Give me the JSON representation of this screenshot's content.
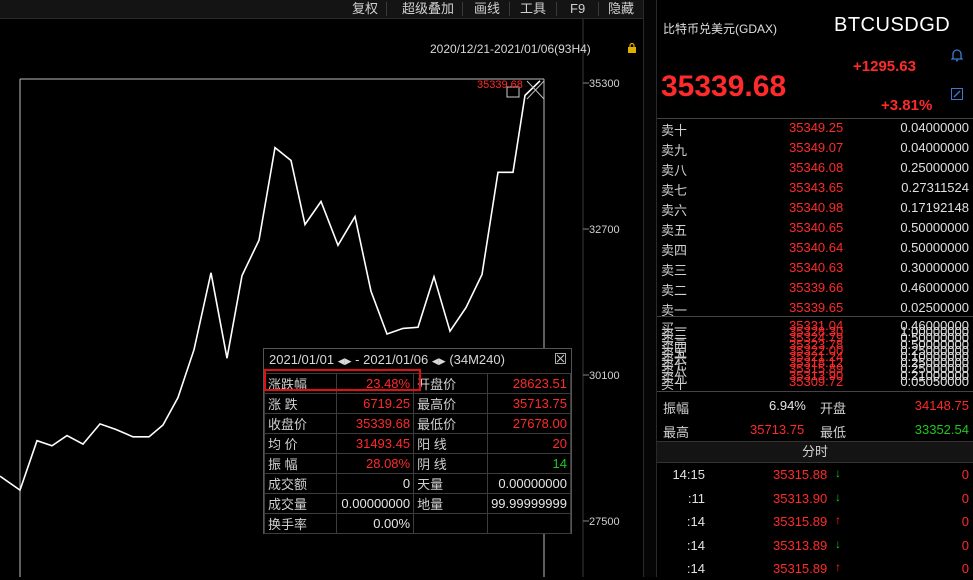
{
  "toolbar": {
    "items": [
      "复权",
      "超级叠加",
      "画线",
      "工具",
      "F9",
      "隐藏"
    ]
  },
  "chart": {
    "range_label": "2020/12/21-2021/01/06(93H4)",
    "last_price_tag": "35339.68",
    "y_ticks": [
      "35300",
      "32700",
      "30100",
      "27500"
    ]
  },
  "chart_data": {
    "type": "line",
    "y_ticks": [
      35300,
      32700,
      30100,
      27500
    ],
    "values": [
      28300,
      28050,
      28930,
      28840,
      29020,
      28870,
      29230,
      29130,
      29000,
      29000,
      29210,
      29700,
      30550,
      31920,
      30400,
      31870,
      32500,
      34150,
      33920,
      32780,
      33190,
      32410,
      32920,
      31590,
      30830,
      30930,
      30950,
      31850,
      30880,
      31300,
      31890,
      33710,
      33710,
      35080,
      35340
    ]
  },
  "stats": {
    "range_from": "2021/01/01",
    "range_to": "2021/01/06",
    "range_sep": "-",
    "period": "(34M240)",
    "rows": [
      {
        "k1": "涨跌幅",
        "v1": "23.48%",
        "k2": "开盘价",
        "v2": "28623.51"
      },
      {
        "k1": "涨  跌",
        "v1": "6719.25",
        "k2": "最高价",
        "v2": "35713.75"
      },
      {
        "k1": "收盘价",
        "v1": "35339.68",
        "k2": "最低价",
        "v2": "27678.00"
      },
      {
        "k1": "均  价",
        "v1": "31493.45",
        "k2": "阳  线",
        "v2": "20"
      },
      {
        "k1": "振  幅",
        "v1": "28.08%",
        "k2": "阴  线",
        "v2": "14"
      },
      {
        "k1": "成交额",
        "v1": "0",
        "k2": "天量",
        "v2": "0.00000000"
      },
      {
        "k1": "成交量",
        "v1": "0.00000000",
        "k2": "地量",
        "v2": "99.99999999"
      },
      {
        "k1": "换手率",
        "v1": "0.00%",
        "k2": "",
        "v2": ""
      }
    ]
  },
  "quote": {
    "name": "比特币兑美元(GDAX)",
    "code": "BTCUSDGD",
    "price": "35339.68",
    "change": "+1295.63",
    "change_pct": "+3.81%"
  },
  "asks": [
    {
      "label": "卖十",
      "price": "35349.25",
      "vol": "0.04000000"
    },
    {
      "label": "卖九",
      "price": "35349.07",
      "vol": "0.04000000"
    },
    {
      "label": "卖八",
      "price": "35346.08",
      "vol": "0.25000000"
    },
    {
      "label": "卖七",
      "price": "35343.65",
      "vol": "0.27311524"
    },
    {
      "label": "卖六",
      "price": "35340.98",
      "vol": "0.17192148"
    },
    {
      "label": "卖五",
      "price": "35340.65",
      "vol": "0.50000000"
    },
    {
      "label": "卖四",
      "price": "35340.64",
      "vol": "0.50000000"
    },
    {
      "label": "卖三",
      "price": "35340.63",
      "vol": "0.30000000"
    },
    {
      "label": "卖二",
      "price": "35339.66",
      "vol": "0.46000000"
    },
    {
      "label": "卖一",
      "price": "35339.65",
      "vol": "0.02500000"
    }
  ],
  "bids_garbled": {
    "labels": [
      "买一",
      "买二",
      "买三",
      "买四",
      "买五",
      "买六",
      "买七",
      "买八",
      "买九",
      "买十"
    ],
    "prices": [
      "35331.04",
      "35328.30",
      "35324.79",
      "35323.78",
      "35322.00",
      "35321.24",
      "35318.12",
      "35315.89",
      "35313.90",
      "35309.72"
    ],
    "vols": [
      "0.46000000",
      "1.00000000",
      "0.50000000",
      "0.50000000",
      "0.25000000",
      "0.10000000",
      "0.25000000",
      "0.25000000",
      "0.21000000",
      "0.05050000"
    ]
  },
  "summary": {
    "amp_label": "振幅",
    "amp_value": "6.94%",
    "open_label": "开盘",
    "open_value": "34148.75",
    "high_label": "最高",
    "high_value": "35713.75",
    "low_label": "最低",
    "low_value": "33352.54"
  },
  "ticks_header": "分时",
  "ticks": [
    {
      "time": "14:15",
      "price": "35315.88",
      "dir": "down",
      "vol": "0"
    },
    {
      "time": ":11",
      "price": "35313.90",
      "dir": "down",
      "vol": "0"
    },
    {
      "time": ":14",
      "price": "35315.89",
      "dir": "up",
      "vol": "0"
    },
    {
      "time": ":14",
      "price": "35313.89",
      "dir": "down",
      "vol": "0"
    },
    {
      "time": ":14",
      "price": "35315.89",
      "dir": "up",
      "vol": "0"
    }
  ],
  "colors": {
    "up": "#ff2a2a",
    "down": "#1ec81e",
    "highlight_box": "#e01010"
  }
}
